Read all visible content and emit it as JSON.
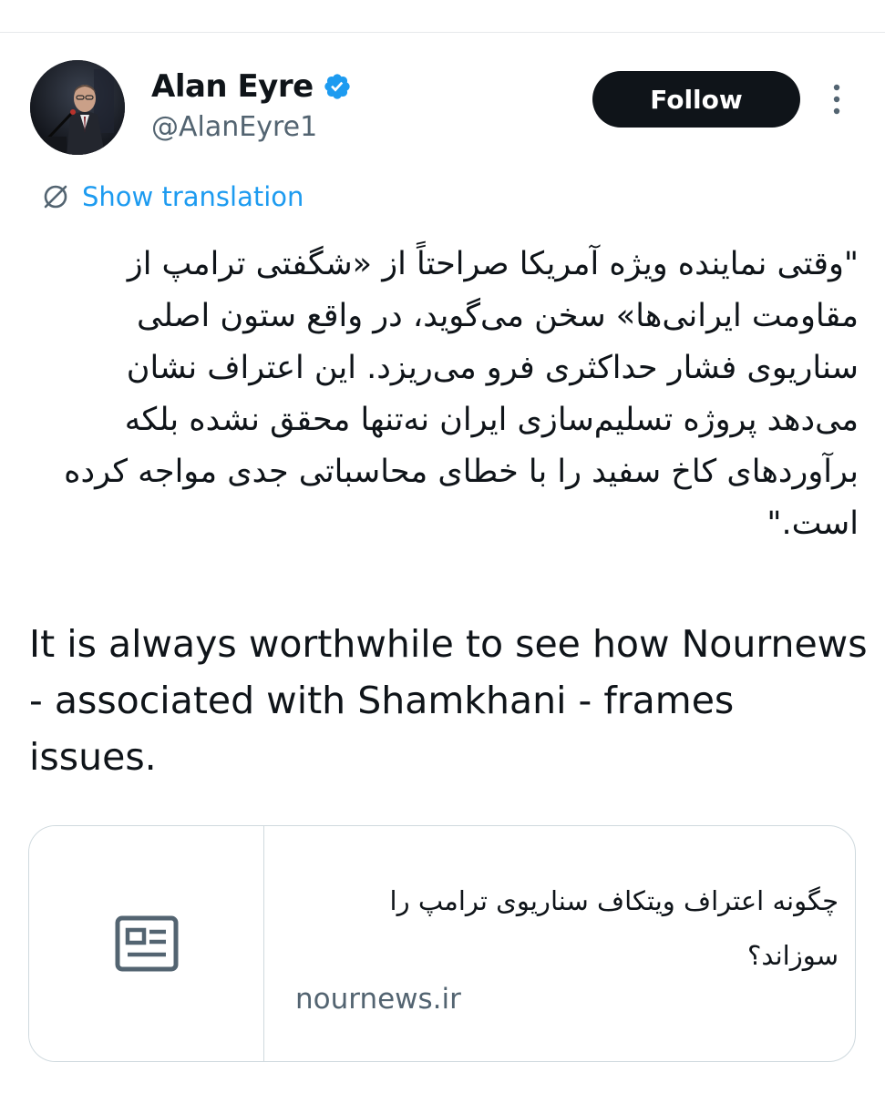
{
  "author": {
    "display_name": "Alan Eyre",
    "handle": "@AlanEyre1",
    "verified": true,
    "avatar_icon": "profile-photo-speaker-at-podium"
  },
  "actions": {
    "follow_label": "Follow",
    "more_icon": "vertical-ellipsis-icon"
  },
  "translation": {
    "label": "Show translation",
    "icon": "globe-translate-icon"
  },
  "tweet": {
    "persian_text": "\"وقتی نماینده ویژه آمریکا صراحتاً از «شگفتی ترامپ از مقاومت ایرانی‌ها» سخن می‌گوید، در واقع ستون اصلی سناریوی فشار حداکثری فرو می‌ریزد. این اعتراف نشان می‌دهد پروژه تسلیم‌سازی ایران نه‌تنها محقق نشده بلکه برآوردهای کاخ سفید را با خطای محاسباتی جدی مواجه کرده است.\"",
    "english_text": "It is always worthwhile to see how Nournews - associated with Shamkhani - frames issues."
  },
  "link_card": {
    "thumbnail_icon": "article-news-icon",
    "title": "چگونه اعتراف ویتکاف سناریوی ترامپ را سوزاند؟",
    "domain": "nournews.ir"
  },
  "colors": {
    "text_primary": "#0f1419",
    "text_secondary": "#536471",
    "accent_blue": "#1d9bf0",
    "border": "#cfd9de",
    "follow_bg": "#0f1419"
  }
}
